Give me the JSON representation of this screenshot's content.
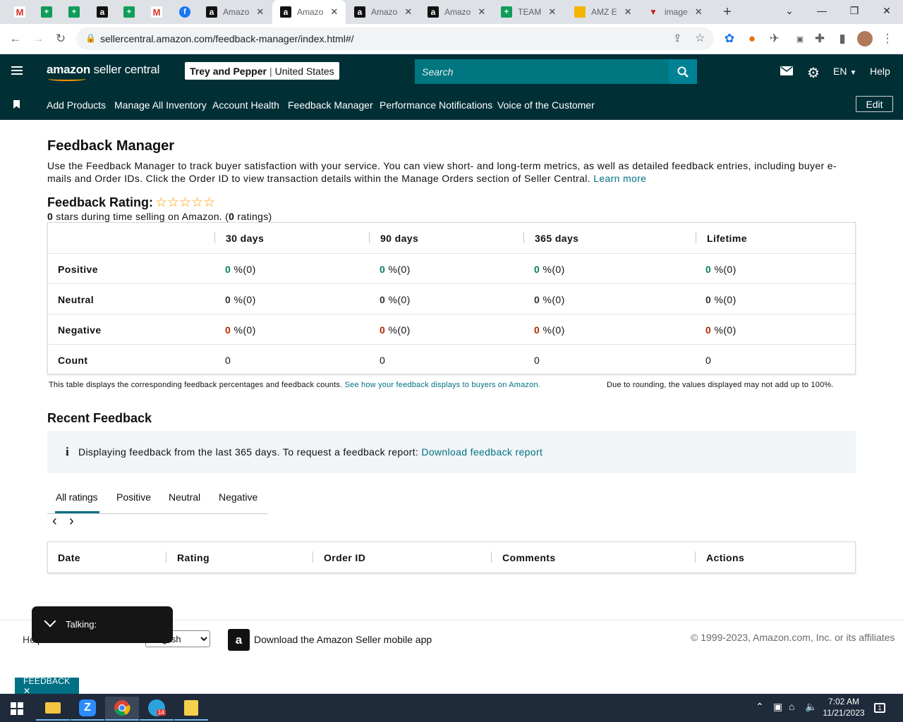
{
  "browser": {
    "tabs": [
      {
        "icon": "gmail-icon",
        "glyph": "M",
        "label": ""
      },
      {
        "icon": "sheets-icon",
        "glyph": "+",
        "label": ""
      },
      {
        "icon": "sheets-icon",
        "glyph": "+",
        "label": ""
      },
      {
        "icon": "amazon-icon",
        "glyph": "a",
        "label": ""
      },
      {
        "icon": "sheets-icon",
        "glyph": "+",
        "label": ""
      },
      {
        "icon": "gmail-icon",
        "glyph": "M",
        "label": ""
      },
      {
        "icon": "facebook-icon",
        "glyph": "f",
        "label": ""
      },
      {
        "icon": "amazon-icon",
        "glyph": "a",
        "label": "Amazo"
      },
      {
        "icon": "amazon-icon",
        "glyph": "a",
        "label": "Amazo"
      },
      {
        "icon": "amazon-icon",
        "glyph": "a",
        "label": "Amazo"
      },
      {
        "icon": "amazon-icon",
        "glyph": "a",
        "label": "Amazo"
      },
      {
        "icon": "sheets-icon",
        "glyph": "+",
        "label": "TEAM"
      },
      {
        "icon": "amze-icon",
        "glyph": "",
        "label": "AMZ E"
      },
      {
        "icon": "image-tab-icon",
        "glyph": "▼",
        "label": "image"
      }
    ],
    "new_tab_glyph": "+",
    "close_glyph": "✕",
    "url": "sellercentral.amazon.com/feedback-manager/index.html#/"
  },
  "header": {
    "logo_bold": "amazon",
    "logo_rest": " seller central",
    "store_name": "Trey and Pepper",
    "marketplace": "United States",
    "search_placeholder": "Search",
    "language": "EN",
    "help": "Help"
  },
  "nav": {
    "items": [
      "Add Products",
      "Manage All Inventory",
      "Account Health",
      "Feedback Manager",
      "Performance Notifications",
      "Voice of the Customer"
    ],
    "edit": "Edit"
  },
  "page": {
    "title": "Feedback Manager",
    "intro": "Use the Feedback Manager to track buyer satisfaction with your service. You can view short- and long-term metrics, as well as detailed feedback entries, including buyer e-mails and Order IDs. Click the Order ID to view transaction details within the Manage Orders section of Seller Central.",
    "learn_more": "Learn more",
    "rating_title": "Feedback Rating:",
    "stars": "☆☆☆☆☆",
    "stars_value": 0,
    "summary_stars": "0",
    "summary_mid": " stars during time selling on Amazon. (",
    "summary_count": "0",
    "summary_end": " ratings)"
  },
  "rating_table": {
    "columns": [
      "30 days",
      "90 days",
      "365 days",
      "Lifetime"
    ],
    "rows": [
      {
        "label": "Positive",
        "type": "pos",
        "values": [
          "0",
          "0",
          "0",
          "0"
        ],
        "suffix": " %(0)"
      },
      {
        "label": "Neutral",
        "type": "neu",
        "values": [
          "0",
          "0",
          "0",
          "0"
        ],
        "suffix": " %(0)"
      },
      {
        "label": "Negative",
        "type": "neg",
        "values": [
          "0",
          "0",
          "0",
          "0"
        ],
        "suffix": " %(0)"
      },
      {
        "label": "Count",
        "type": "plain",
        "values": [
          "0",
          "0",
          "0",
          "0"
        ],
        "suffix": ""
      }
    ],
    "note": "This table displays the corresponding feedback percentages and feedback counts.",
    "note_link": "See how your feedback displays to buyers on Amazon.",
    "rounding_note": "Due to rounding, the values displayed may not add up to 100%."
  },
  "recent": {
    "title": "Recent Feedback",
    "info_icon": "i",
    "info_text": "Displaying feedback from the last 365 days. To request a feedback report:",
    "download_link": "Download feedback report",
    "tabs": [
      "All ratings",
      "Positive",
      "Neutral",
      "Negative"
    ],
    "prev": "‹",
    "next": "›",
    "columns": [
      "Date",
      "Rating",
      "Order ID",
      "Comments",
      "Actions"
    ]
  },
  "footer": {
    "help": "Help",
    "language_select": "English",
    "app_text": "Download the Amazon Seller mobile app",
    "copyright": "© 1999-2023, Amazon.com, Inc. or its affiliates"
  },
  "overlay": {
    "talking": "Talking:",
    "feedback_tab": "FEEDBACK ✕"
  },
  "taskbar": {
    "time": "7:02 AM",
    "date": "11/21/2023",
    "telegram_badge": "14",
    "notification_count": "1"
  },
  "colors": {
    "header_bg": "#002f36",
    "link": "#007185",
    "positive": "#067d62",
    "negative": "#b12704",
    "star": "#ff9900"
  }
}
